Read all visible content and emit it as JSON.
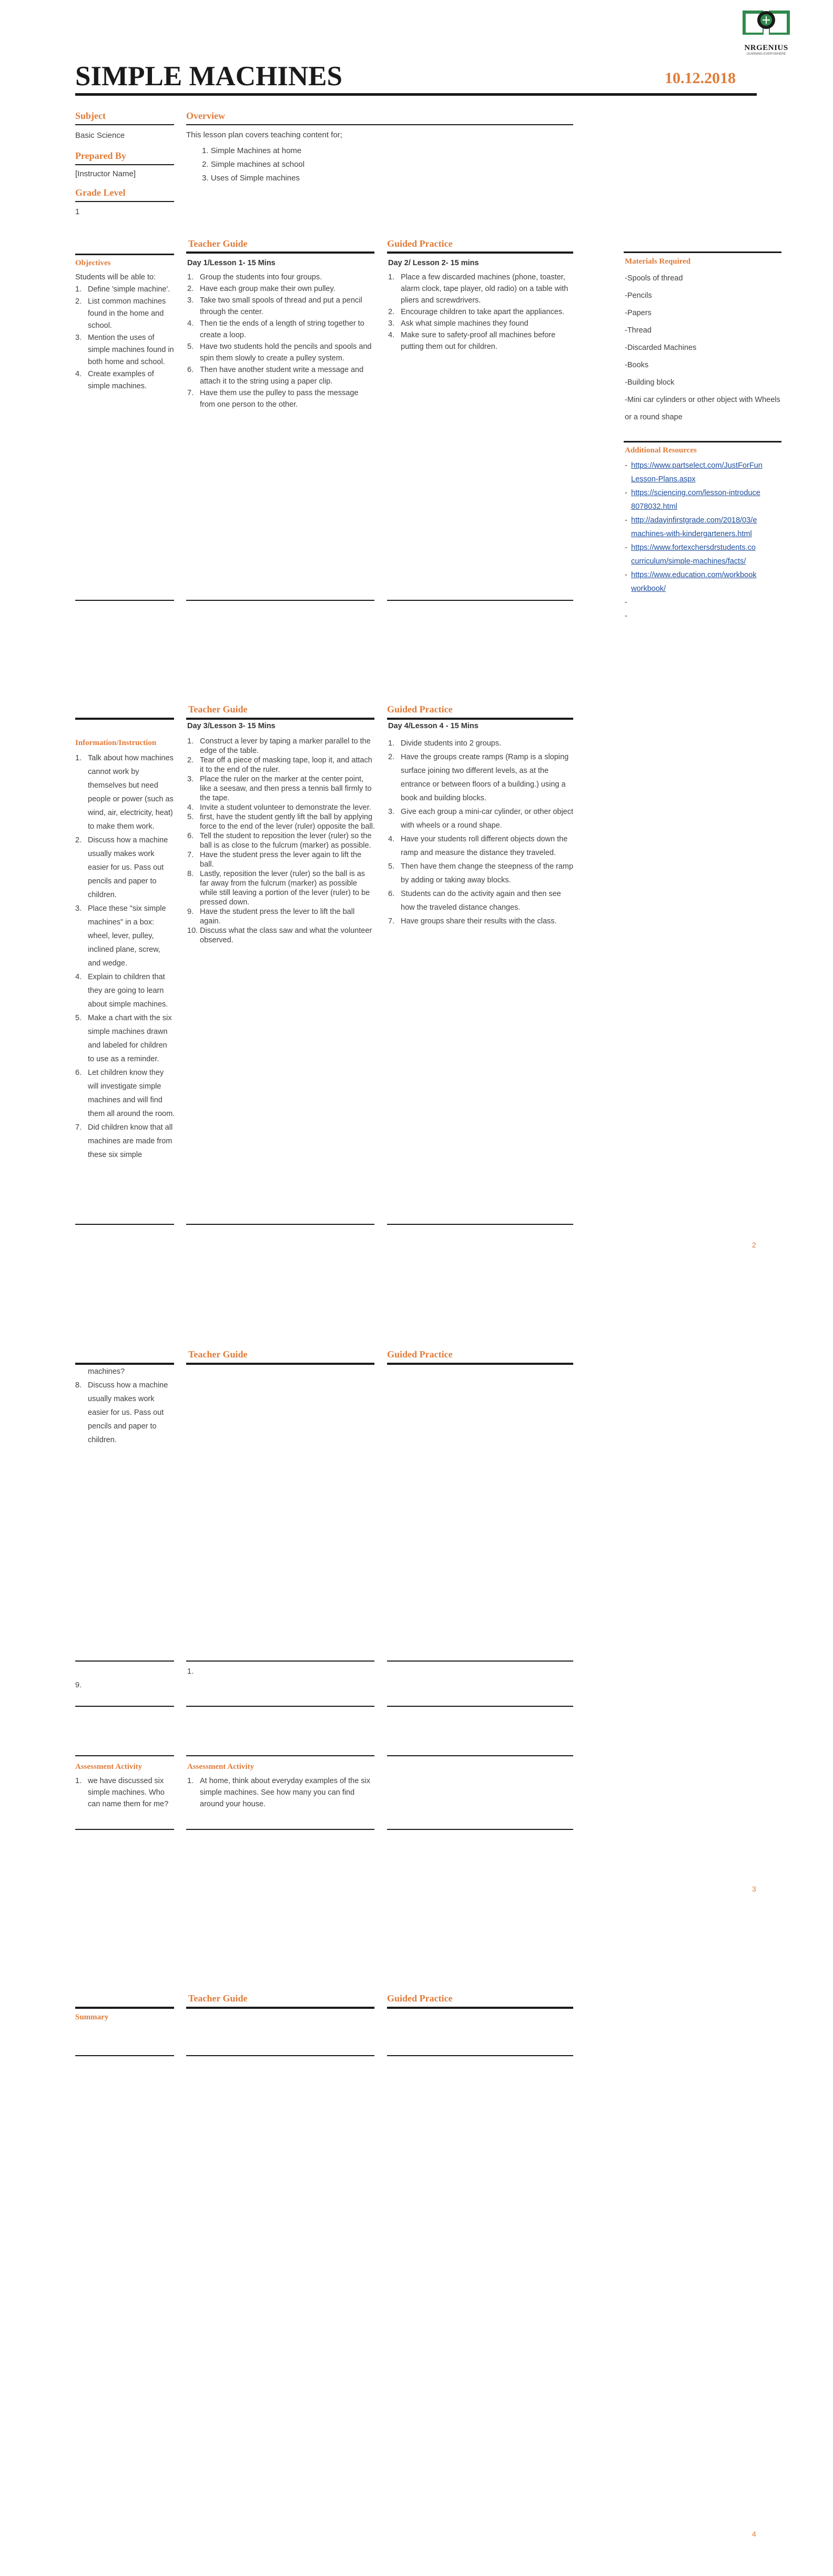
{
  "logo": {
    "name": "NRGENIUS",
    "tagline": "LEARNING EVERYWHERE"
  },
  "header": {
    "title": "SIMPLE MACHINES",
    "date": "10.12.2018"
  },
  "meta": {
    "subject_label": "Subject",
    "subject_value": "Basic Science",
    "prepared_label": "Prepared By",
    "prepared_value": "[Instructor Name]",
    "grade_label": "Grade Level",
    "grade_value": "1"
  },
  "overview": {
    "label": "Overview",
    "intro": "This lesson plan covers teaching content for;",
    "items": [
      "Simple Machines at home",
      "Simple machines at school",
      "Uses of Simple machines"
    ]
  },
  "section1": {
    "teacher_guide_label": "Teacher Guide",
    "guided_practice_label": "Guided Practice",
    "objectives_label": "Objectives",
    "objectives_intro": "Students will be able to:",
    "objectives": [
      {
        "n": "1.",
        "t": "Define 'simple machine'."
      },
      {
        "n": "2.",
        "t": "List common machines found in the home and school."
      },
      {
        "n": "3.",
        "t": "Mention the uses of simple machines found in both home and school."
      },
      {
        "n": "4.",
        "t": "Create examples of simple machines."
      }
    ],
    "day1_title": "Day 1/Lesson 1- 15 Mins",
    "day1": [
      {
        "n": "1.",
        "t": "Group the students into four groups."
      },
      {
        "n": "2.",
        "t": "Have each group make their own pulley."
      },
      {
        "n": "3.",
        "t": "Take two small spools of thread and put a pencil through the center."
      },
      {
        "n": "4.",
        "t": "Then tie the ends of a length of string together to create a loop."
      },
      {
        "n": "5.",
        "t": "Have two students hold the pencils and spools and spin them slowly to create a pulley system."
      },
      {
        "n": "6.",
        "t": "Then have another student write a message and attach it to the string using a paper clip."
      },
      {
        "n": "7.",
        "t": "Have them use the pulley to pass the message from one person to the other."
      }
    ],
    "day2_title": "Day 2/ Lesson 2- 15 mins",
    "day2": [
      {
        "n": "1.",
        "t": "Place a few discarded machines (phone, toaster, alarm clock, tape player, old radio) on a table with pliers and screwdrivers."
      },
      {
        "n": "2.",
        "t": "Encourage children to take apart the appliances."
      },
      {
        "n": "3.",
        "t": "Ask what simple machines they found"
      },
      {
        "n": "4.",
        "t": "Make sure to safety-proof all machines before putting them out for children."
      }
    ]
  },
  "sidebar": {
    "materials_label": "Materials Required",
    "materials": [
      "-Spools of thread",
      "-Pencils",
      "-Papers",
      "-Thread",
      "-Discarded Machines",
      "-Books",
      "-Building block",
      "-Mini car cylinders or other object with Wheels or a round shape"
    ],
    "resources_label": "Additional Resources",
    "resources": [
      {
        "l1": "https://www.partselect.com/JustForFun",
        "l2": "Lesson-Plans.aspx"
      },
      {
        "l1": "https://sciencing.com/lesson-introduce",
        "l2": "8078032.html"
      },
      {
        "l1": "http://adayinfirstgrade.com/2018/03/e",
        "l2": "machines-with-kindergarteners.html"
      },
      {
        "l1": "https://www.fortexchersdrstudents.co",
        "l2": "curriculum/simple-machines/facts/"
      },
      {
        "l1": "https://www.education.com/workbook",
        "l2": "workbook/"
      }
    ],
    "dashes": [
      "-",
      "-"
    ]
  },
  "section2": {
    "teacher_guide_label": "Teacher Guide",
    "guided_practice_label": "Guided Practice",
    "info_label": "Information/Instruction",
    "info": [
      {
        "n": "1.",
        "t": "Talk about how machines cannot work by themselves but need people or power (such as wind, air, electricity, heat) to make them work."
      },
      {
        "n": "2.",
        "t": "Discuss how a machine usually makes work easier for us. Pass out pencils and paper to children."
      },
      {
        "n": "3.",
        "t": "Place these \"six simple machines\" in a box: wheel, lever, pulley, inclined plane, screw, and wedge."
      },
      {
        "n": "4.",
        "t": "Explain to children that they are going to learn about simple machines."
      },
      {
        "n": "5.",
        "t": "Make a chart with the six simple machines drawn and labeled for children to use as a reminder."
      },
      {
        "n": "6.",
        "t": "Let children know they will investigate simple machines and will find them all around the room."
      },
      {
        "n": "7.",
        "t": "Did children know that all machines are made from these six simple"
      }
    ],
    "day3_title": "Day 3/Lesson 3- 15 Mins",
    "day3": [
      {
        "n": "1.",
        "t": "Construct a lever by taping a marker parallel to the edge of the table."
      },
      {
        "n": "2.",
        "t": "Tear off a piece of masking tape, loop it, and attach it to the end of the ruler."
      },
      {
        "n": "3.",
        "t": "Place the ruler on the marker at the center point, like a seesaw, and then press a tennis ball firmly to the tape."
      },
      {
        "n": "4.",
        "t": "Invite a student volunteer to demonstrate the lever."
      },
      {
        "n": "5.",
        "t": "first, have the student gently lift the ball by applying force to the end of the lever (ruler) opposite the ball."
      },
      {
        "n": "6.",
        "t": "Tell the student to reposition the lever (ruler) so the ball is as close to the fulcrum (marker) as possible."
      },
      {
        "n": "7.",
        "t": "Have the student press the lever again to lift the ball."
      },
      {
        "n": "8.",
        "t": "Lastly, reposition the lever (ruler) so the ball is as far away from the fulcrum (marker) as possible while still leaving a portion of the lever (ruler) to be pressed down."
      },
      {
        "n": "9.",
        "t": "Have the student press the lever to lift the ball again."
      },
      {
        "n": "10.",
        "t": "Discuss what the class saw and what the volunteer observed."
      }
    ],
    "day4_title": "Day 4/Lesson 4 - 15 Mins",
    "day4": [
      {
        "n": "1.",
        "t": "Divide students into 2 groups."
      },
      {
        "n": "2.",
        "t": "Have the groups create ramps (Ramp is a sloping surface joining two different levels, as at the entrance or between floors of a building.) using a book and building blocks."
      },
      {
        "n": "3.",
        "t": "Give each group a mini-car cylinder, or other object with wheels or a round shape."
      },
      {
        "n": "4.",
        "t": "Have your students roll different objects down the ramp and measure the distance they traveled."
      },
      {
        "n": "5.",
        "t": "Then have them change the steepness of the ramp by adding or taking away blocks."
      },
      {
        "n": "6.",
        "t": "Students can do the activity again and then see how the traveled distance changes."
      },
      {
        "n": "7.",
        "t": "Have groups share their results with the class."
      }
    ],
    "page": "2"
  },
  "section3": {
    "teacher_guide_label": "Teacher Guide",
    "guided_practice_label": "Guided Practice",
    "cont_first": "machines?",
    "cont": [
      {
        "n": "8.",
        "t": "Discuss how a machine usually makes work easier for us. Pass out pencils and paper to children."
      }
    ],
    "nine": "9.",
    "one": "1.",
    "assess_label_left": "Assessment Activity",
    "assess_left": [
      {
        "n": "1.",
        "t": "we have discussed six simple machines. Who can name them for me?"
      }
    ],
    "assess_label_mid": "Assessment Activity",
    "assess_mid": [
      {
        "n": "1.",
        "t": "At home, think about everyday examples of the six simple machines. See how many you can find around your house."
      }
    ],
    "page": "3"
  },
  "section4": {
    "teacher_guide_label": "Teacher Guide",
    "guided_practice_label": "Guided Practice",
    "summary_label": "Summary",
    "page": "4"
  }
}
